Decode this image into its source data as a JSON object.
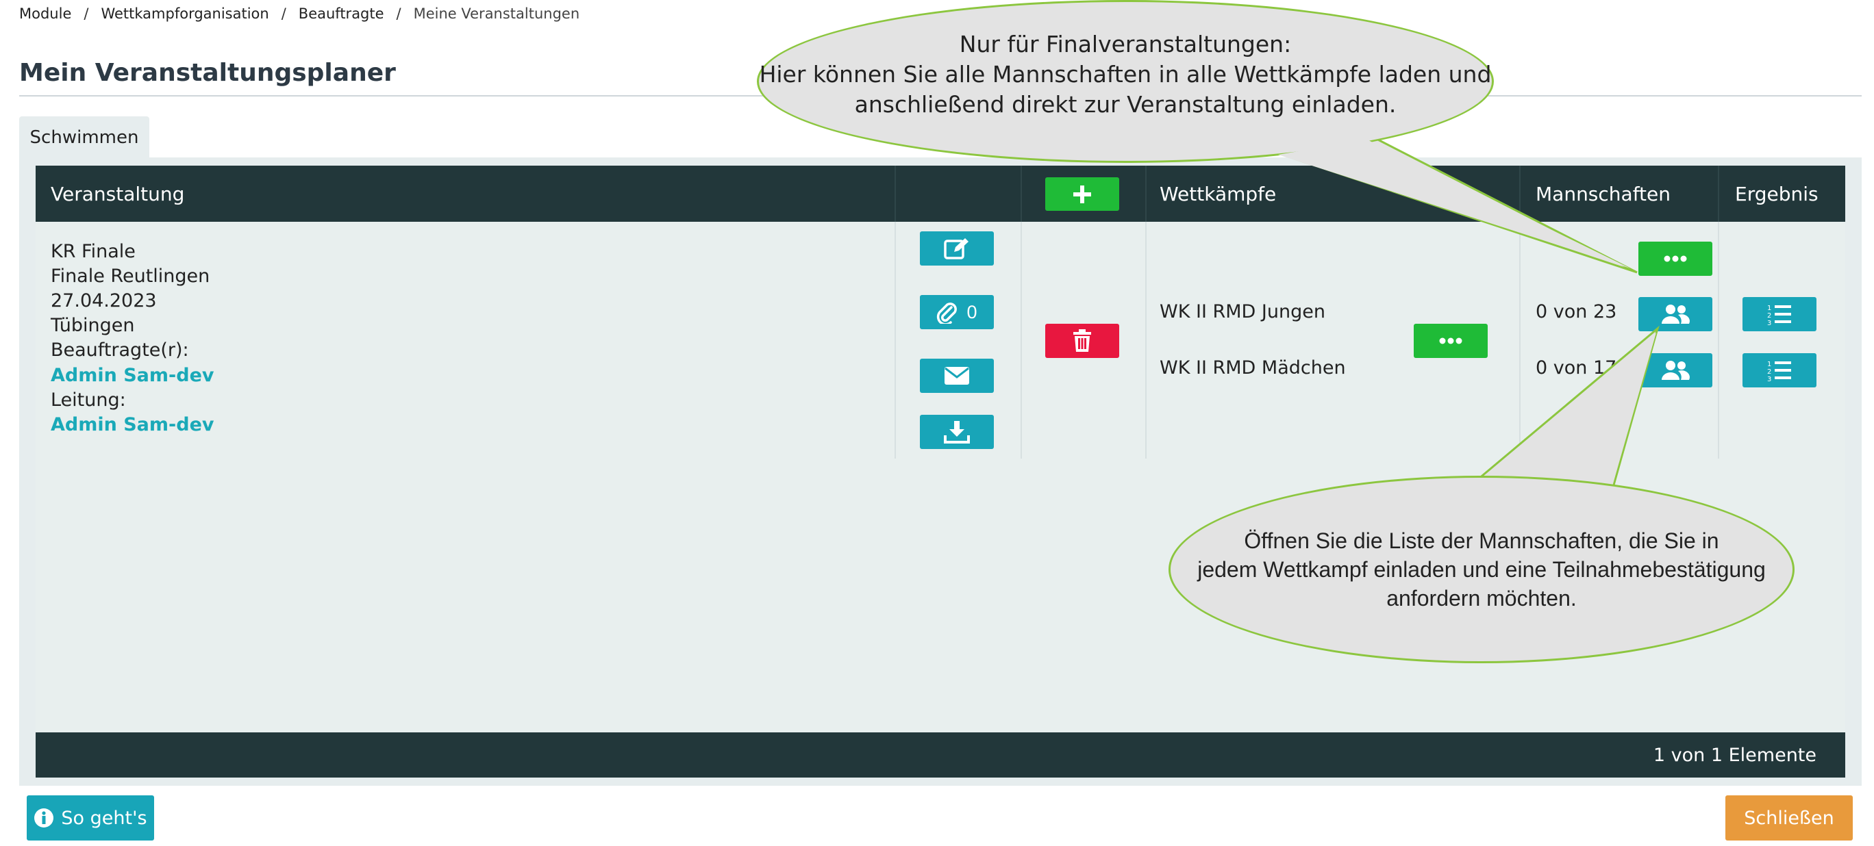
{
  "breadcrumb": {
    "items": [
      "Module",
      "Wettkampforganisation",
      "Beauftragte"
    ],
    "separator": "/",
    "current": "Meine Veranstaltungen"
  },
  "page_title": "Mein Veranstaltungsplaner",
  "tabs": [
    {
      "label": "Schwimmen"
    }
  ],
  "table": {
    "headers": {
      "event": "Veranstaltung",
      "competitions": "Wettkämpfe",
      "teams": "Mannschaften",
      "result": "Ergebnis"
    },
    "row": {
      "lines": [
        "KR Finale",
        "Finale Reutlingen",
        "27.04.2023",
        "Tübingen",
        "Beauftragte(r):"
      ],
      "commissioner": "Admin Sam-dev",
      "lead_label": "Leitung:",
      "lead": "Admin Sam-dev",
      "attachment_count": "0",
      "competitions": [
        {
          "name": "WK II RMD Jungen",
          "teams": "0 von 23"
        },
        {
          "name": "WK II RMD Mädchen",
          "teams": "0 von 17"
        }
      ]
    },
    "footer": "1 von 1 Elemente"
  },
  "callouts": {
    "top": [
      "Nur für Finalveranstaltungen:",
      "Hier können Sie alle Mannschaften in alle Wettkämpfe laden und",
      "anschließend direkt zur Veranstaltung einladen."
    ],
    "bottom": [
      "Öffnen Sie die Liste der Mannschaften, die Sie in",
      "jedem Wettkampf einladen und eine Teilnahmebestätigung",
      "anfordern möchten."
    ]
  },
  "buttons": {
    "help": "So geht's",
    "close": "Schließen"
  },
  "colors": {
    "header_bg": "#22373a",
    "teal": "#18a5b8",
    "green": "#1fbb37",
    "red": "#e8173f",
    "orange": "#e89a3c",
    "link": "#1aa9b8",
    "callout_border": "#8cc63f"
  },
  "icons": [
    "edit-icon",
    "paperclip-icon",
    "envelope-icon",
    "download-icon",
    "trash-icon",
    "plus-icon",
    "ellipsis-icon",
    "users-icon",
    "list-ordered-icon",
    "info-icon"
  ]
}
